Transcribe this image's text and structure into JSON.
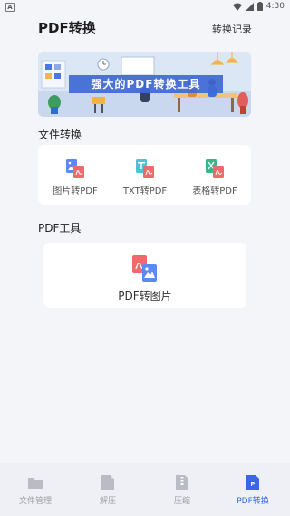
{
  "status_bar": {
    "notification_icon": "A",
    "time": "4:30"
  },
  "header": {
    "title": "PDF转换",
    "history_link": "转换记录"
  },
  "banner": {
    "title": "强大的PDF转换工具"
  },
  "file_convert": {
    "label": "文件转换",
    "tools": [
      {
        "label": "图片转PDF",
        "icon": "image-to-pdf-icon"
      },
      {
        "label": "TXT转PDF",
        "icon": "txt-to-pdf-icon"
      },
      {
        "label": "表格转PDF",
        "icon": "excel-to-pdf-icon"
      }
    ]
  },
  "pdf_tools": {
    "label": "PDF工具",
    "tools": [
      {
        "label": "PDF转图片",
        "icon": "pdf-to-image-icon"
      }
    ]
  },
  "bottom_nav": {
    "items": [
      {
        "label": "文件管理",
        "icon": "folder-icon",
        "active": false
      },
      {
        "label": "解压",
        "icon": "document-icon",
        "active": false
      },
      {
        "label": "压缩",
        "icon": "zip-icon",
        "active": false
      },
      {
        "label": "PDF转换",
        "icon": "pdf-icon",
        "active": true
      }
    ]
  },
  "colors": {
    "accent": "#3a67ea",
    "pdf_red": "#ef6a6a",
    "image_blue": "#5b8bf2",
    "txt_teal": "#4fc3d6",
    "excel_green": "#35b98a"
  }
}
